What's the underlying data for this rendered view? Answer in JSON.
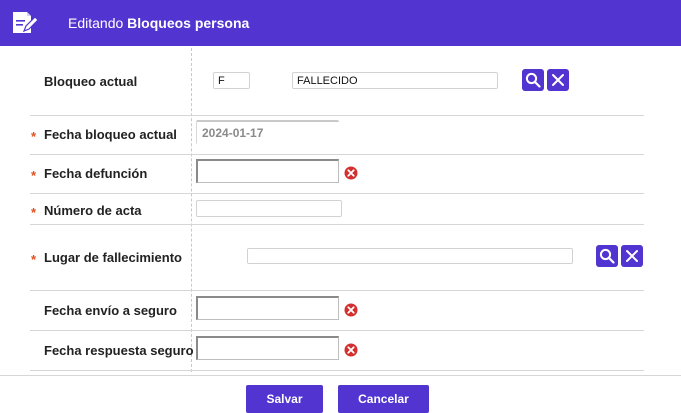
{
  "header": {
    "prefix": "Editando",
    "title": "Bloqueos persona",
    "icon": "edit-document-icon"
  },
  "form": {
    "bloqueo_actual": {
      "label": "Bloqueo actual",
      "code": "F",
      "description": "FALLECIDO"
    },
    "fecha_bloqueo_actual": {
      "label": "Fecha bloqueo actual",
      "required_mark": "*",
      "value": "2024-01-17"
    },
    "fecha_defuncion": {
      "label": "Fecha defunción",
      "required_mark": "*",
      "value": ""
    },
    "numero_acta": {
      "label": "Número de acta",
      "required_mark": "*",
      "value": ""
    },
    "lugar_fallecimiento": {
      "label": "Lugar de fallecimiento",
      "required_mark": "*",
      "value": ""
    },
    "fecha_envio_seguro": {
      "label": "Fecha envío a seguro",
      "value": ""
    },
    "fecha_respuesta_seguro": {
      "label": "Fecha respuesta seguro",
      "value": ""
    }
  },
  "footer": {
    "save_label": "Salvar",
    "cancel_label": "Cancelar"
  },
  "colors": {
    "accent": "#5234d1",
    "required": "#e0501c",
    "clear_icon": "#d32f2f"
  }
}
